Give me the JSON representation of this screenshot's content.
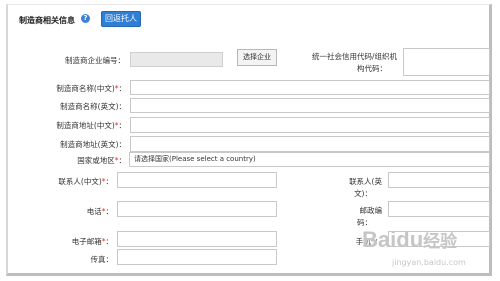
{
  "header": {
    "section_title": "制造商相关信息",
    "help_icon": "question-icon",
    "return_button": "回返托人"
  },
  "fields": {
    "company_no": "制造商企业编号：",
    "select_company_button": "选择企业",
    "credit_code_line1": "统一社会信用代码/组织机",
    "credit_code_line2": "构代码：",
    "name_cn": "制造商名称(中文)",
    "name_en": "制造商名称(英文)：",
    "address_cn": "制造商地址(中文)",
    "address_en": "制造商地址(英文)：",
    "country": "国家或地区",
    "country_placeholder": "请选择国家(Please select a country)",
    "contact_cn": "联系人(中文)",
    "contact_en_line1": "联系人(英",
    "contact_en_line2": "文)：",
    "phone": "电话",
    "postcode_line1": "邮政编",
    "postcode_line2": "码：",
    "email": "电子邮箱",
    "mobile": "手机",
    "fax": "传真："
  },
  "required_mark": "*",
  "colon": "：",
  "watermark": {
    "brand": "Bai",
    "paw": "du",
    "suffix": "经验",
    "url": "jingyan.baidu.com"
  }
}
